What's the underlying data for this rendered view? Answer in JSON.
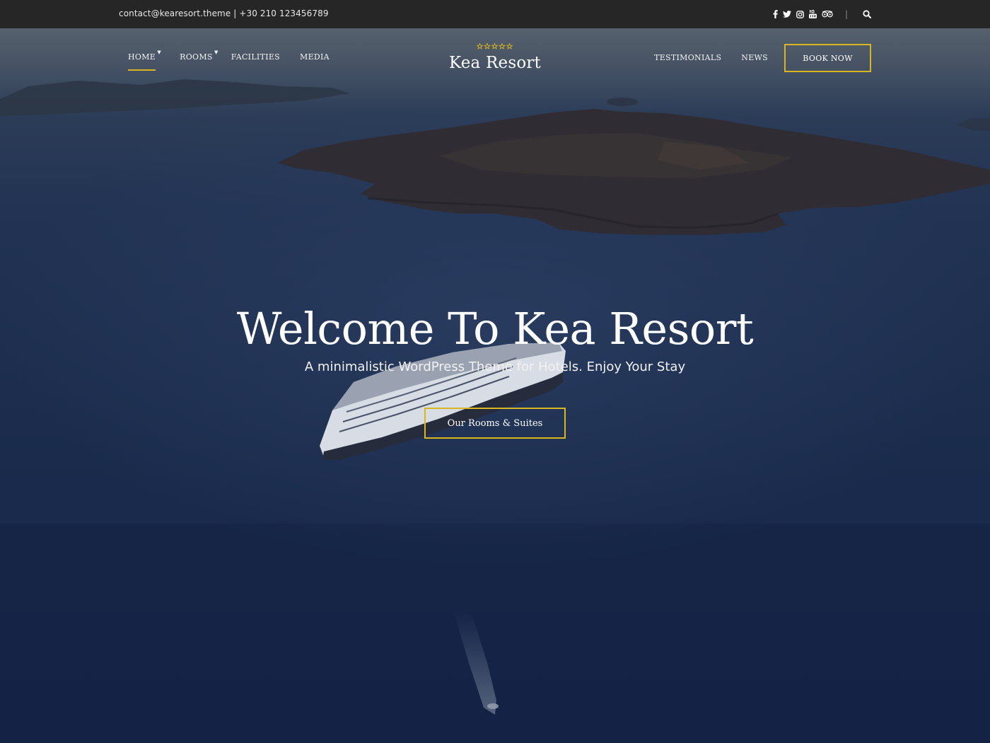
{
  "topbar": {
    "contact": "contact@kearesort.theme | +30 210 123456789",
    "social": [
      {
        "icon": "facebook-icon"
      },
      {
        "icon": "twitter-icon"
      },
      {
        "icon": "instagram-icon"
      },
      {
        "icon": "youtube-icon"
      },
      {
        "icon": "tripadvisor-icon"
      }
    ],
    "separator": "|",
    "search_icon": "search-icon"
  },
  "nav": {
    "left": [
      {
        "label": "HOME",
        "active": true,
        "has_dropdown": true
      },
      {
        "label": "ROOMS",
        "active": false,
        "has_dropdown": true
      },
      {
        "label": "FACILITIES",
        "active": false,
        "has_dropdown": false
      },
      {
        "label": "MEDIA",
        "active": false,
        "has_dropdown": false
      }
    ],
    "right": [
      {
        "label": "TESTIMONIALS"
      },
      {
        "label": "NEWS"
      }
    ],
    "book_button": "BOOK NOW"
  },
  "logo": {
    "stars": 5,
    "name": "Kea Resort"
  },
  "hero": {
    "title": "Welcome To Kea Resort",
    "subtitle": "A minimalistic WordPress Theme for Hotels. Enjoy Your Stay",
    "cta": "Our Rooms & Suites"
  },
  "colors": {
    "accent": "#d8b61f",
    "topbar": "#262626",
    "text": "#ffffff"
  }
}
